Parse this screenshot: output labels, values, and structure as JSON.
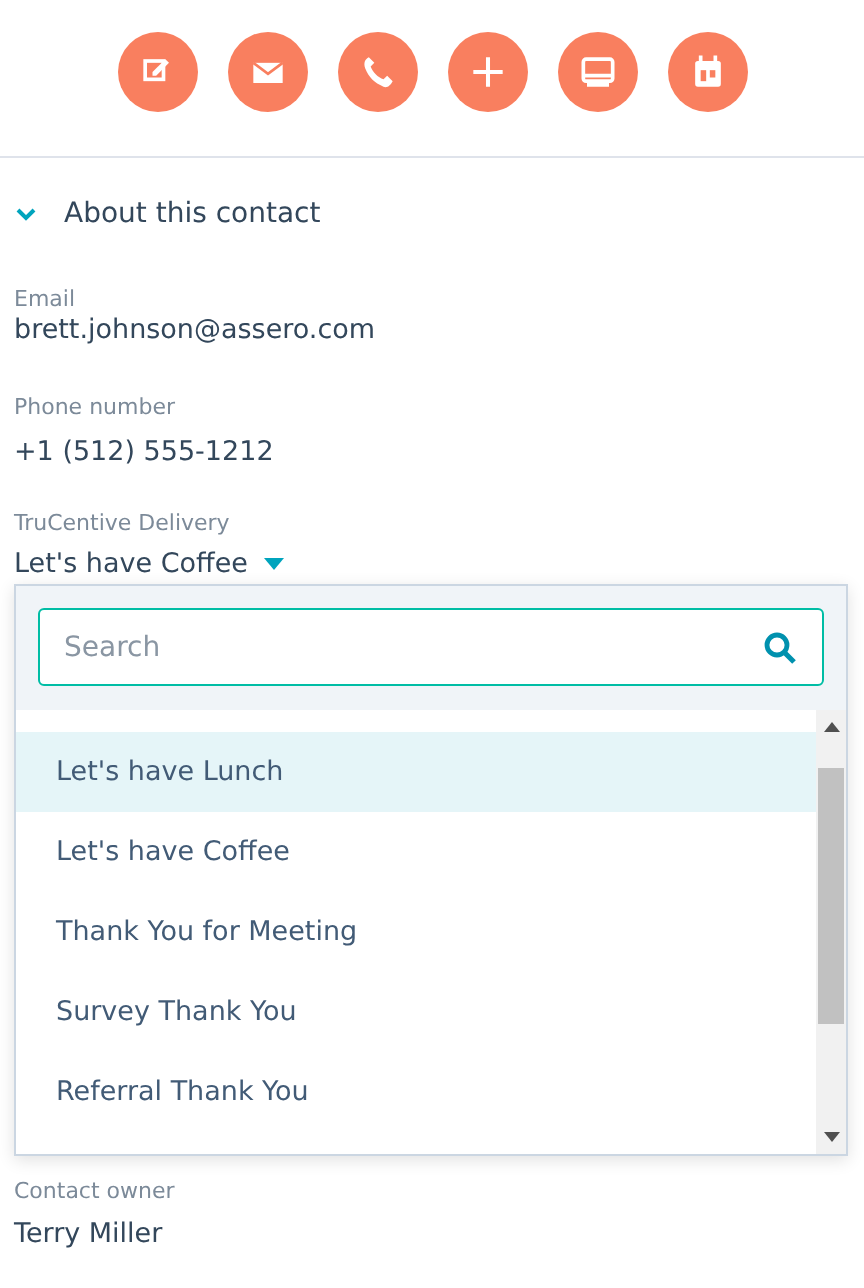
{
  "actions": [
    {
      "kind": "note"
    },
    {
      "kind": "email"
    },
    {
      "kind": "call"
    },
    {
      "kind": "add"
    },
    {
      "kind": "screen"
    },
    {
      "kind": "calendar"
    }
  ],
  "section": {
    "title": "About this contact",
    "expanded": true
  },
  "fields": [
    {
      "label": "Email",
      "value": "brett.johnson@assero.com"
    },
    {
      "label": "Phone number",
      "value": "+1 (512) 555-1212"
    }
  ],
  "delivery": {
    "label": "TruCentive Delivery",
    "value": "Let's have Coffee",
    "expanded": true,
    "search": {
      "placeholder": "Search"
    },
    "options": [
      {
        "label": "Let's have Lunch",
        "highlighted": true
      },
      {
        "label": "Let's have Coffee",
        "highlighted": false
      },
      {
        "label": "Thank You for Meeting",
        "highlighted": false
      },
      {
        "label": "Survey Thank You",
        "highlighted": false
      },
      {
        "label": "Referral Thank You",
        "highlighted": false
      }
    ]
  },
  "owner": {
    "label": "Contact owner",
    "value": "Terry Miller"
  }
}
